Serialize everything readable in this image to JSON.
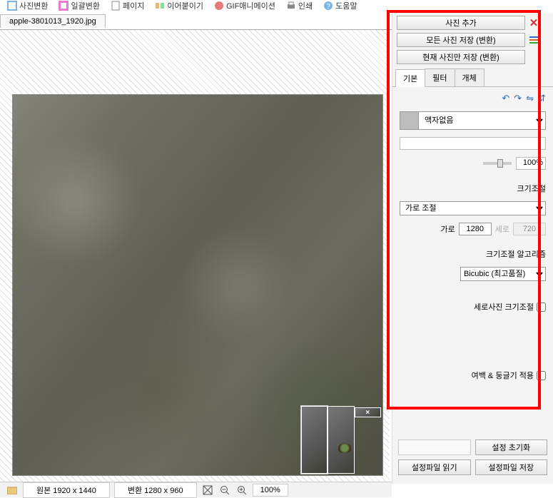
{
  "menubar": {
    "items": [
      {
        "label": "사진변환"
      },
      {
        "label": "일괄변환"
      },
      {
        "label": "페이지"
      },
      {
        "label": "이어붙이기"
      },
      {
        "label": "GIF애니메이션"
      },
      {
        "label": "인쇄"
      },
      {
        "label": "도움말"
      }
    ]
  },
  "file_tab": "apple-3801013_1920.jpg",
  "status": {
    "original": "원본 1920 x 1440",
    "converted": "변환 1280 x 960",
    "zoom": "100%"
  },
  "panel": {
    "buttons": {
      "add_photo": "사진 추가",
      "save_all": "모든 사진 저장 (변환)",
      "save_current": "현재 사진만 저장 (변환)"
    },
    "tabs": [
      "기본",
      "필터",
      "개체"
    ],
    "frame_option": "액자없음",
    "opacity_pct": "100%",
    "resize": {
      "section_label": "크기조절",
      "mode": "가로 조절",
      "width_label": "가로",
      "width_value": "1280",
      "height_label": "세로",
      "height_value": "720",
      "algo_label": "크기조절 알고리즘",
      "algo_value": "Bicubic (최고품질)",
      "portrait_label": "세로사진 크기조절"
    },
    "margin_label": "여백 & 둥글기 적용",
    "bottom": {
      "reset": "설정 초기화",
      "read": "설정파일 읽기",
      "save": "설정파일 저장"
    }
  }
}
